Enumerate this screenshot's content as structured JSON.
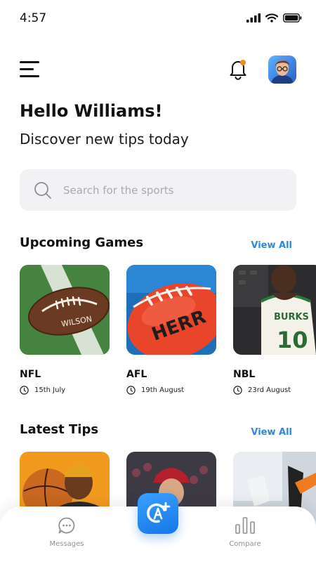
{
  "status_bar": {
    "time": "4:57"
  },
  "header": {
    "menu_icon": "hamburger-menu-icon",
    "notification_icon": "bell-icon",
    "notification_dot_color": "#f08a24",
    "avatar": "user-avatar"
  },
  "greeting": {
    "title": "Hello Williams!",
    "subtitle": "Discover new tips today"
  },
  "search": {
    "placeholder": "Search for the sports",
    "value": ""
  },
  "upcoming": {
    "title": "Upcoming Games",
    "view_all": "View All",
    "games": [
      {
        "name": "NFL",
        "date": "15th July",
        "image": "american-football-on-grass"
      },
      {
        "name": "AFL",
        "date": "19th August",
        "image": "red-afl-football"
      },
      {
        "name": "NBL",
        "date": "23rd August",
        "image": "basketball-player-jersey"
      }
    ]
  },
  "latest_tips": {
    "title": "Latest Tips",
    "view_all": "View All",
    "tips": [
      {
        "image": "man-with-basketball-orange"
      },
      {
        "image": "baseball-pitcher"
      },
      {
        "image": "soccer-players-ball"
      }
    ]
  },
  "bottom_nav": {
    "items": [
      {
        "label": "Messages",
        "icon": "chat-bubble-icon"
      },
      {
        "label": "Compare",
        "icon": "bar-chart-icon"
      }
    ],
    "fab_icon": "tips-ai-plus-icon"
  },
  "colors": {
    "accent": "#2f87e2",
    "fab": "#1f86f0",
    "notification": "#f08a24"
  }
}
